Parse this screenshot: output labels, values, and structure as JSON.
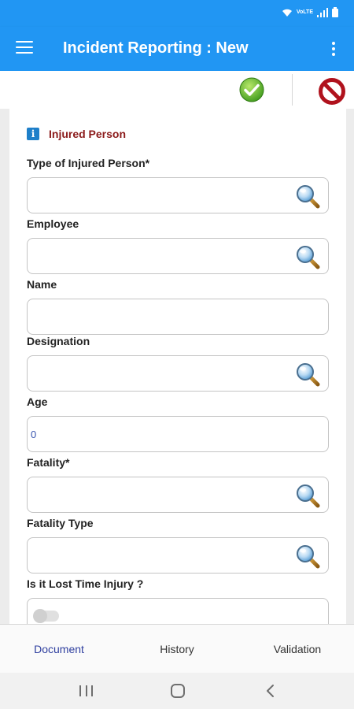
{
  "app_bar": {
    "title": "Incident Reporting : New"
  },
  "actions": {
    "save_icon": "check-circle-icon",
    "cancel_icon": "no-entry-icon"
  },
  "section": {
    "title": "Injured Person",
    "icon": "info-icon"
  },
  "fields": {
    "type_of_injured_person": {
      "label": "Type of Injured Person*",
      "value": ""
    },
    "employee": {
      "label": "Employee",
      "value": ""
    },
    "name": {
      "label": "Name",
      "value": ""
    },
    "designation": {
      "label": "Designation",
      "value": ""
    },
    "age": {
      "label": "Age",
      "value": "0"
    },
    "fatality": {
      "label": "Fatality*",
      "value": ""
    },
    "fatality_type": {
      "label": "Fatality Type",
      "value": ""
    },
    "lost_time_injury": {
      "label": "Is it Lost Time Injury ?",
      "checked": false
    }
  },
  "tabs": [
    {
      "label": "Document",
      "active": true
    },
    {
      "label": "History",
      "active": false
    },
    {
      "label": "Validation",
      "active": false
    }
  ],
  "colors": {
    "primary": "#2196f3",
    "section_title": "#8b1a1a",
    "active_tab": "#2f3f9f"
  }
}
